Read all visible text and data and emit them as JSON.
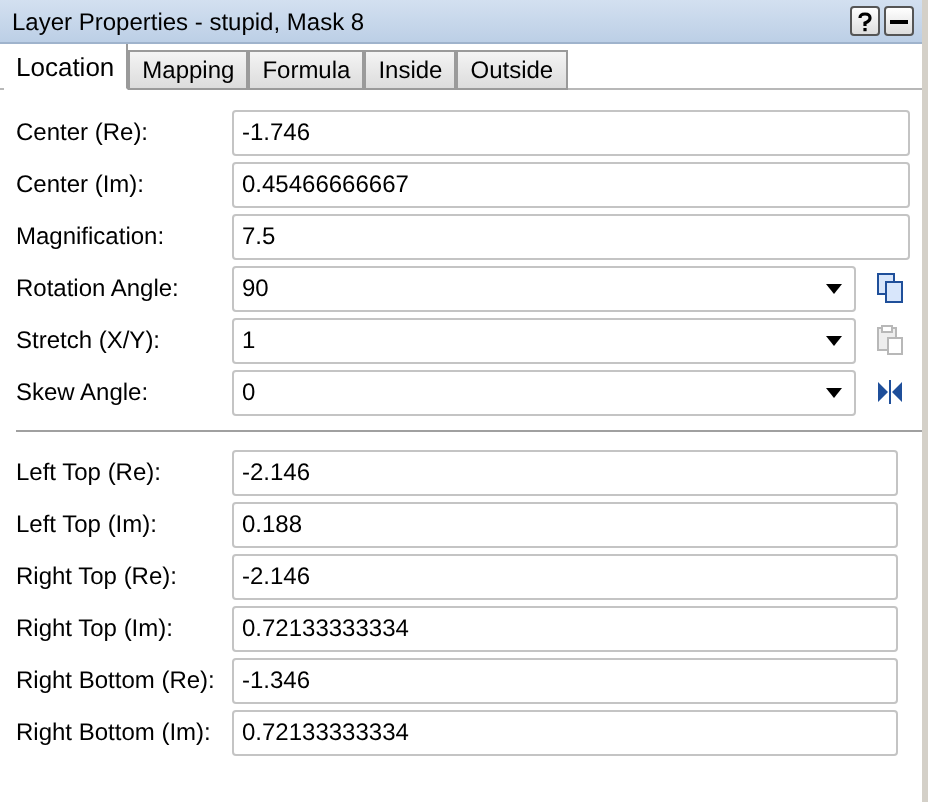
{
  "window": {
    "title": "Layer Properties - stupid, Mask 8"
  },
  "tabs": [
    {
      "label": "Location",
      "selected": true
    },
    {
      "label": "Mapping",
      "selected": false
    },
    {
      "label": "Formula",
      "selected": false
    },
    {
      "label": "Inside",
      "selected": false
    },
    {
      "label": "Outside",
      "selected": false
    }
  ],
  "fields": [
    {
      "label": "Center (Re):",
      "value": "-1.746",
      "kind": "text"
    },
    {
      "label": "Center (Im):",
      "value": "0.45466666667",
      "kind": "text"
    },
    {
      "label": "Magnification:",
      "value": "7.5",
      "kind": "text"
    },
    {
      "label": "Rotation Angle:",
      "value": "90",
      "kind": "combo",
      "action": {
        "kind": "copy",
        "disabled": false
      }
    },
    {
      "label": "Stretch (X/Y):",
      "value": "1",
      "kind": "combo",
      "action": {
        "kind": "paste",
        "disabled": true
      }
    },
    {
      "label": "Skew Angle:",
      "value": "0",
      "kind": "combo",
      "action": {
        "kind": "mirror",
        "disabled": false
      }
    }
  ],
  "corners": [
    {
      "label": "Left Top (Re):",
      "value": "-2.146"
    },
    {
      "label": "Left Top (Im):",
      "value": "0.188"
    },
    {
      "label": "Right Top (Re):",
      "value": "-2.146"
    },
    {
      "label": "Right Top (Im):",
      "value": "0.72133333334"
    },
    {
      "label": "Right Bottom (Re):",
      "value": "-1.346"
    },
    {
      "label": "Right Bottom (Im):",
      "value": "0.72133333334"
    }
  ]
}
